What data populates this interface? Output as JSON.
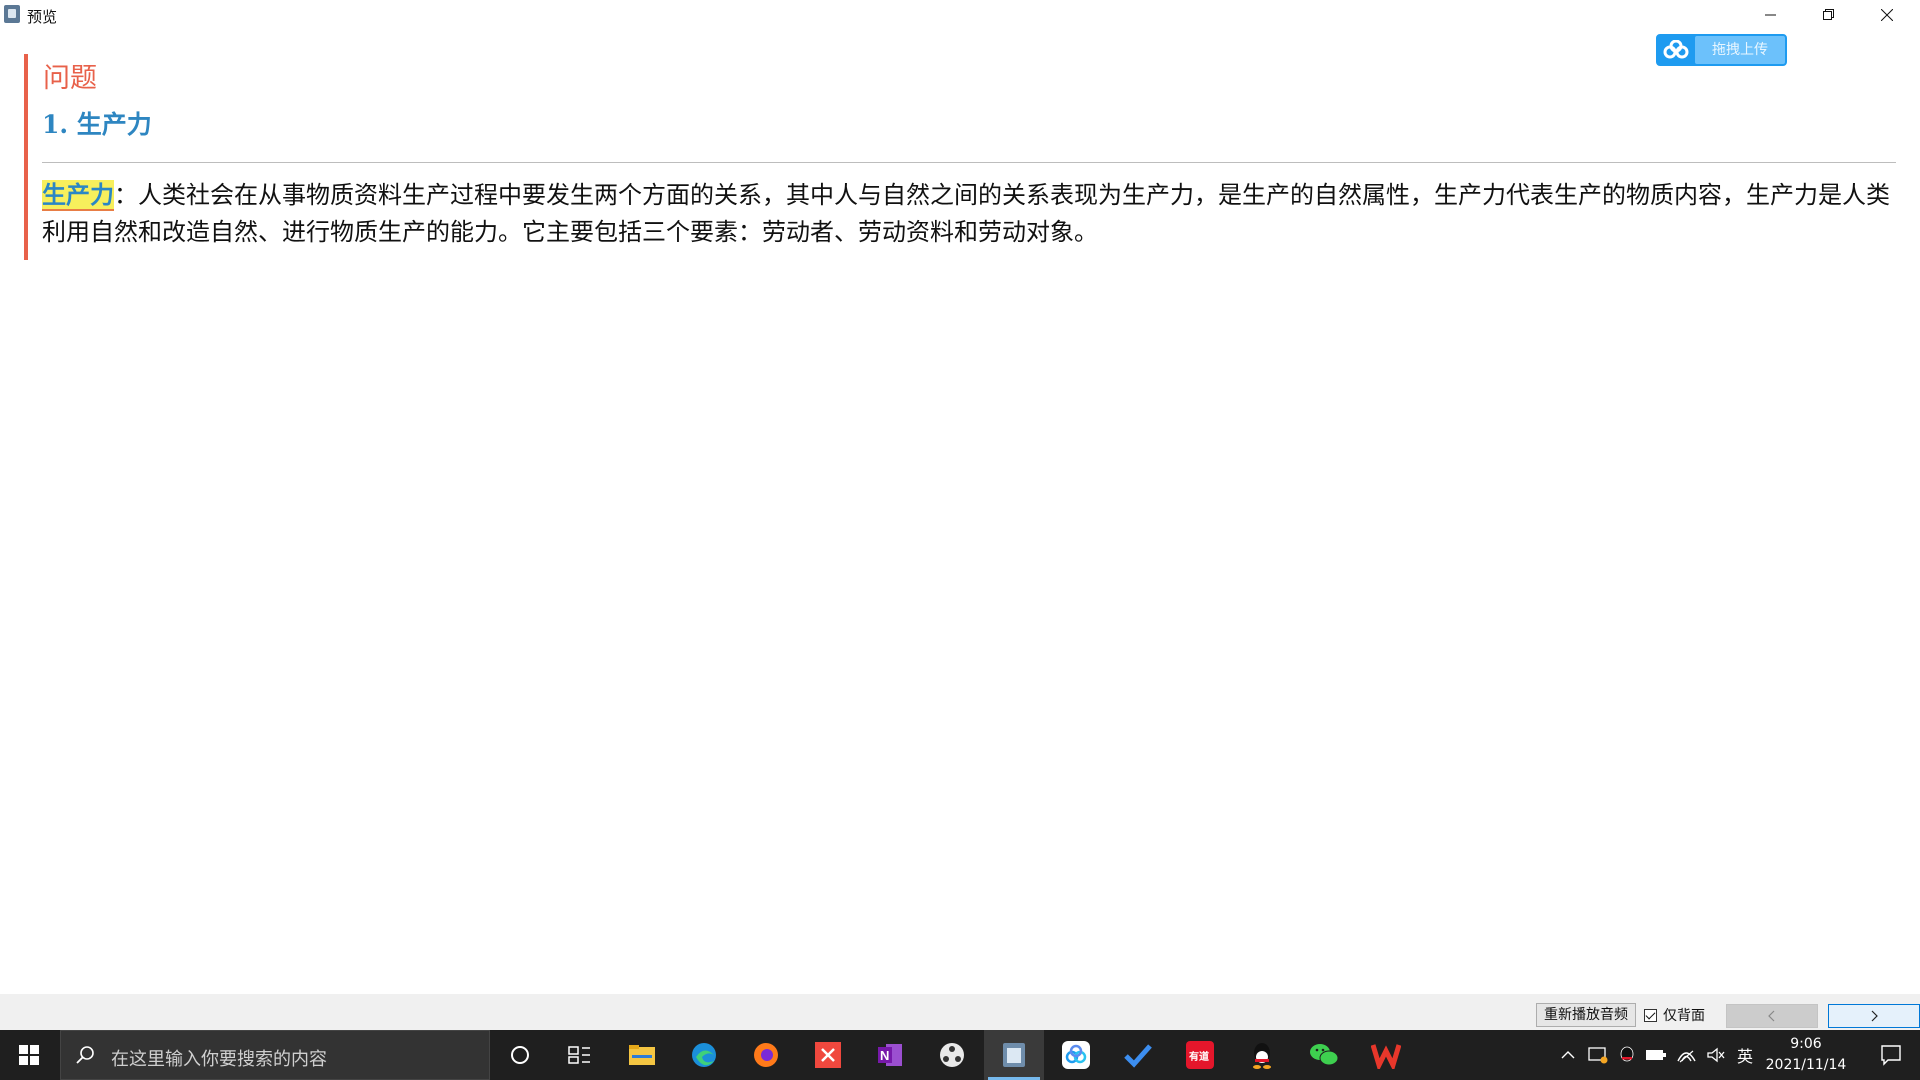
{
  "window": {
    "title": "预览"
  },
  "upload": {
    "label": "拖拽上传"
  },
  "card": {
    "question_label": "问题",
    "heading": "1. 生产力",
    "term": "生产力",
    "definition": "：人类社会在从事物质资料生产过程中要发生两个方面的关系，其中人与自然之间的关系表现为生产力，是生产的自然属性，生产力代表生产的物质内容，生产力是人类利用自然和改造自然、进行物质生产的能力。它主要包括三个要素：劳动者、劳动资料和劳动对象。"
  },
  "controls": {
    "replay_label": "重新播放音频",
    "back_only_label": "仅背面",
    "back_only_checked": true,
    "prev_symbol": "‹",
    "next_symbol": "›"
  },
  "taskbar": {
    "search_placeholder": "在这里输入你要搜索的内容",
    "icons": [
      "cortana-icon",
      "task-view-icon",
      "file-explorer-icon",
      "edge-icon",
      "firefox-icon",
      "xmind-icon",
      "onenote-icon",
      "davinci-icon",
      "preview-app-icon",
      "baidu-netdisk-icon",
      "todo-icon",
      "youdao-icon",
      "qq-icon",
      "wechat-icon",
      "wps-icon"
    ],
    "ime": "英",
    "time": "9:06",
    "date": "2021/11/14"
  },
  "colors": {
    "accent": "#e8614a",
    "heading": "#2e86c1",
    "highlight": "#f7ef5c",
    "upload": "#1e9bf0"
  }
}
